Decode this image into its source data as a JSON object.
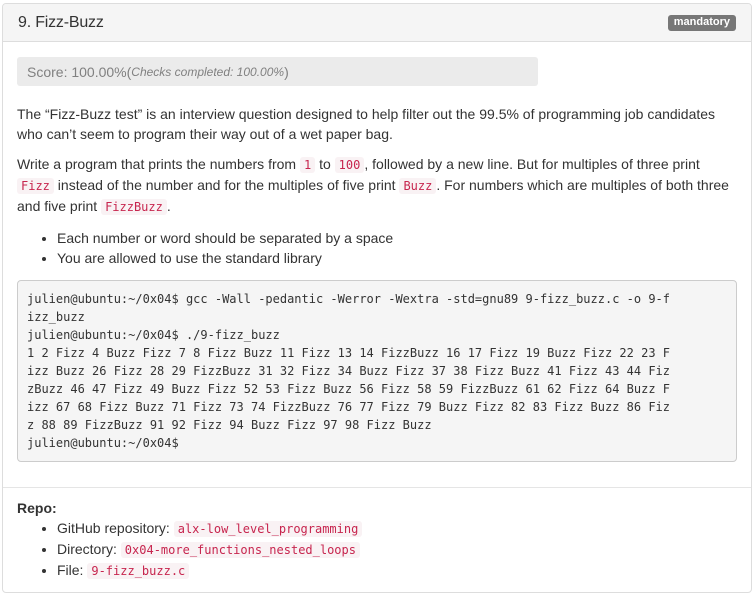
{
  "task": {
    "title": "9. Fizz-Buzz",
    "badge": "mandatory"
  },
  "score": {
    "text": "Score: 100.00%",
    "checks_open": " (",
    "checks": "Checks completed: 100.00%",
    "checks_close": ")"
  },
  "description": {
    "intro": "The “Fizz-Buzz test” is an interview question designed to help filter out the 99.5% of programming job candidates who can’t seem to program their way out of a wet paper bag.",
    "p2_a": "Write a program that prints the numbers from ",
    "p2_code1": "1",
    "p2_b": " to ",
    "p2_code2": "100",
    "p2_c": ", followed by a new line. But for multiples of three print ",
    "p2_code3": "Fizz",
    "p2_d": " instead of the number and for the multiples of five print ",
    "p2_code4": "Buzz",
    "p2_e": ". For numbers which are multiples of both three and five print ",
    "p2_code5": "FizzBuzz",
    "p2_f": ".",
    "bullets": [
      "Each number or word should be separated by a space",
      "You are allowed to use the standard library"
    ]
  },
  "terminal": {
    "lines": [
      "julien@ubuntu:~/0x04$ gcc -Wall -pedantic -Werror -Wextra -std=gnu89 9-fizz_buzz.c -o 9-f",
      "izz_buzz",
      "julien@ubuntu:~/0x04$ ./9-fizz_buzz",
      "1 2 Fizz 4 Buzz Fizz 7 8 Fizz Buzz 11 Fizz 13 14 FizzBuzz 16 17 Fizz 19 Buzz Fizz 22 23 F",
      "izz Buzz 26 Fizz 28 29 FizzBuzz 31 32 Fizz 34 Buzz Fizz 37 38 Fizz Buzz 41 Fizz 43 44 Fiz",
      "zBuzz 46 47 Fizz 49 Buzz Fizz 52 53 Fizz Buzz 56 Fizz 58 59 FizzBuzz 61 62 Fizz 64 Buzz F",
      "izz 67 68 Fizz Buzz 71 Fizz 73 74 FizzBuzz 76 77 Fizz 79 Buzz Fizz 82 83 Fizz Buzz 86 Fiz",
      "z 88 89 FizzBuzz 91 92 Fizz 94 Buzz Fizz 97 98 Fizz Buzz",
      "julien@ubuntu:~/0x04$"
    ]
  },
  "repo": {
    "label": "Repo:",
    "items": [
      {
        "key": "GitHub repository: ",
        "value": "alx-low_level_programming"
      },
      {
        "key": "Directory: ",
        "value": "0x04-more_functions_nested_loops"
      },
      {
        "key": "File: ",
        "value": "9-fizz_buzz.c"
      }
    ]
  }
}
